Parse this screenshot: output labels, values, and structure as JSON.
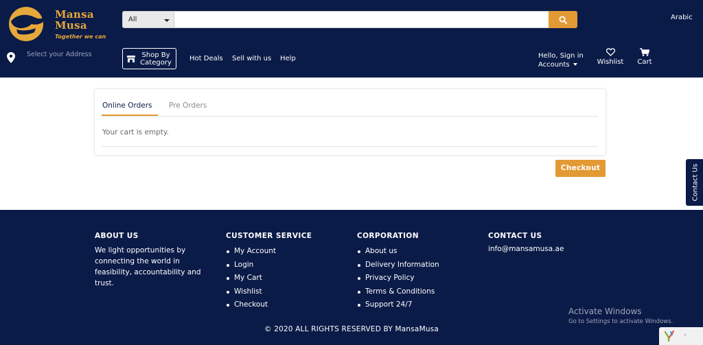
{
  "header": {
    "brand": {
      "name_line1": "Mansa",
      "name_line2": "Musa",
      "tagline": "Together we can"
    },
    "search": {
      "category": "All",
      "placeholder": ""
    },
    "language": "Arabic",
    "address": "Select your Address",
    "shop_by_category": {
      "line1": "Shop By",
      "line2": "Category"
    },
    "nav": {
      "hot_deals": "Hot Deals",
      "sell": "Sell with us",
      "help": "Help"
    },
    "account": {
      "line1": "Hello, Sign in",
      "line2": "Accounts"
    },
    "wishlist": "Wishlist",
    "cart": "Cart"
  },
  "orders": {
    "tabs": [
      {
        "label": "Online Orders"
      },
      {
        "label": "Pre Orders"
      }
    ],
    "empty_message": "Your cart is empty.",
    "checkout_label": "Checkout"
  },
  "contact_tab": "Contact Us",
  "footer": {
    "about": {
      "heading": "ABOUT US",
      "text": "We light opportunities by connecting the world in feasibility, accountability and trust."
    },
    "customer_service": {
      "heading": "CUSTOMER SERVICE",
      "items": [
        "My Account",
        "Login",
        "My Cart",
        "Wishlist",
        "Checkout"
      ]
    },
    "corporation": {
      "heading": "CORPORATION",
      "items": [
        "About us",
        "Delivery Information",
        "Privacy Policy",
        "Terms & Conditions",
        "Support 24/7"
      ]
    },
    "contact": {
      "heading": "CONTACT US",
      "email": "info@mansamusa.ae"
    },
    "copyright": "© 2020 ALL RIGHTS RESERVED BY MansaMusa"
  },
  "os_overlay": {
    "title": "Activate Windows",
    "subtitle": "Go to Settings to activate Windows."
  },
  "colors": {
    "navy": "#0b1b48",
    "accent": "#e29a34",
    "white": "#ffffff"
  },
  "icons": [
    "map-pin-icon",
    "store-icon",
    "search-icon",
    "heart-icon",
    "cart-icon",
    "caret-down-icon"
  ]
}
